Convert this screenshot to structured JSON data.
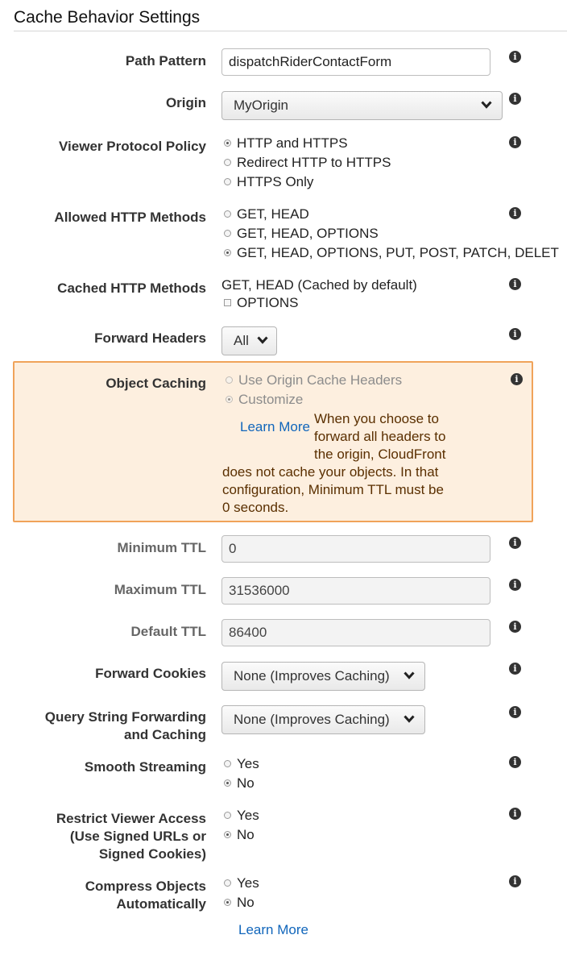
{
  "section_title": "Cache Behavior Settings",
  "path_pattern": {
    "label": "Path Pattern",
    "value": "dispatchRiderContactForm"
  },
  "origin": {
    "label": "Origin",
    "value": "MyOrigin"
  },
  "viewer_protocol_policy": {
    "label": "Viewer Protocol Policy",
    "options": [
      "HTTP and HTTPS",
      "Redirect HTTP to HTTPS",
      "HTTPS Only"
    ],
    "selected": "HTTP and HTTPS"
  },
  "allowed_http_methods": {
    "label": "Allowed HTTP Methods",
    "options": [
      "GET, HEAD",
      "GET, HEAD, OPTIONS",
      "GET, HEAD, OPTIONS, PUT, POST, PATCH, DELET"
    ],
    "selected": "GET, HEAD, OPTIONS, PUT, POST, PATCH, DELET"
  },
  "cached_http_methods": {
    "label": "Cached HTTP Methods",
    "default_text": "GET, HEAD (Cached by default)",
    "options_checkbox": "OPTIONS"
  },
  "forward_headers": {
    "label": "Forward Headers",
    "value": "All"
  },
  "object_caching": {
    "label": "Object Caching",
    "options": [
      "Use Origin Cache Headers",
      "Customize"
    ],
    "selected": "Customize",
    "learn_more": "Learn More",
    "warning_lines": [
      "When you choose to",
      "forward all headers to",
      "the origin, CloudFront",
      "does not cache your objects. In that",
      "configuration, Minimum TTL must be",
      "0 seconds."
    ]
  },
  "minimum_ttl": {
    "label": "Minimum TTL",
    "value": "0"
  },
  "maximum_ttl": {
    "label": "Maximum TTL",
    "value": "31536000"
  },
  "default_ttl": {
    "label": "Default TTL",
    "value": "86400"
  },
  "forward_cookies": {
    "label": "Forward Cookies",
    "value": "None (Improves Caching)"
  },
  "query_string": {
    "label_line1": "Query String Forwarding",
    "label_line2": "and Caching",
    "value": "None (Improves Caching)"
  },
  "smooth_streaming": {
    "label": "Smooth Streaming",
    "options": [
      "Yes",
      "No"
    ],
    "selected": "No"
  },
  "restrict_viewer_access": {
    "label_line1": "Restrict Viewer Access",
    "label_line2": "(Use Signed URLs or",
    "label_line3": "Signed Cookies)",
    "options": [
      "Yes",
      "No"
    ],
    "selected": "No"
  },
  "compress_objects": {
    "label_line1": "Compress Objects",
    "label_line2": "Automatically",
    "options": [
      "Yes",
      "No"
    ],
    "selected": "No",
    "learn_more": "Learn More"
  },
  "info_icon_glyph": "i"
}
